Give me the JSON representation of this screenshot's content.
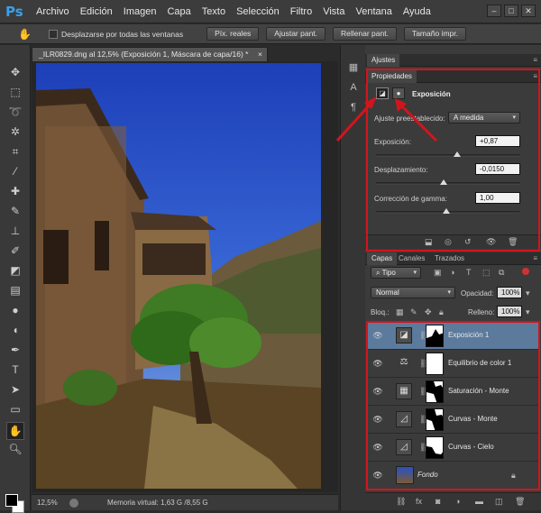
{
  "app": {
    "logo": "Ps",
    "menu": [
      "Archivo",
      "Edición",
      "Imagen",
      "Capa",
      "Texto",
      "Selección",
      "Filtro",
      "Vista",
      "Ventana",
      "Ayuda"
    ],
    "window_buttons": [
      "–",
      "□",
      "✕"
    ]
  },
  "options_bar": {
    "checkbox_label": "Desplazarse por todas las ventanas",
    "buttons": [
      "Píx. reales",
      "Ajustar pant.",
      "Rellenar pant.",
      "Tamaño impr."
    ]
  },
  "document": {
    "tab_title": "_ILR0829.dng al 12,5% (Exposición 1, Máscara de capa/16) *",
    "tab_close": "×",
    "zoom": "12,5%",
    "status": "Memoria virtual: 1,63 G /8,55 G"
  },
  "adjustments_panel": {
    "tab": "Ajustes"
  },
  "properties_panel": {
    "tab": "Propiedades",
    "adjustment_name": "Exposición",
    "preset_label": "Ajuste preestablecido:",
    "preset_value": "A medida",
    "exposure_label": "Exposición:",
    "exposure_value": "+0,87",
    "exposure_level": 0.56,
    "offset_label": "Desplazamiento:",
    "offset_value": "-0,0150",
    "offset_level": 0.47,
    "gamma_label": "Corrección de gamma:",
    "gamma_value": "1,00",
    "gamma_level": 0.49
  },
  "layers_panel": {
    "tabs": [
      "Capas",
      "Canales",
      "Trazados"
    ],
    "filter_label": "Tipo",
    "blend_mode": "Normal",
    "opacity_label": "Opacidad:",
    "opacity_value": "100%",
    "lock_label": "Bloq.:",
    "fill_label": "Relleno:",
    "fill_value": "100%",
    "layers": [
      {
        "name": "Exposición 1",
        "selected": true
      },
      {
        "name": "Equilibrio de color 1",
        "selected": false
      },
      {
        "name": "Saturación - Monte",
        "selected": false
      },
      {
        "name": "Curvas - Monte",
        "selected": false
      },
      {
        "name": "Curvas - Cielo",
        "selected": false
      },
      {
        "name": "Fondo",
        "selected": false
      }
    ]
  },
  "colors": {
    "highlight_red": "#d4141c",
    "selected_layer": "#5c7a9c",
    "ps_blue": "#3aa0e8"
  }
}
